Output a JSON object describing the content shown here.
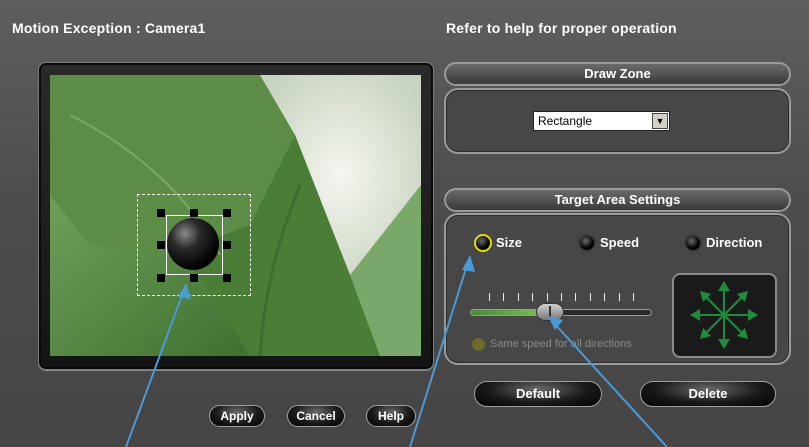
{
  "header": {
    "title": "Motion Exception : Camera1",
    "help_hint": "Refer to help for proper operation"
  },
  "draw_zone": {
    "title": "Draw Zone",
    "shape_select": {
      "value": "Rectangle"
    }
  },
  "target_area": {
    "title": "Target Area Settings",
    "options": [
      {
        "label": "Size",
        "selected": true
      },
      {
        "label": "Speed",
        "selected": false
      },
      {
        "label": "Direction",
        "selected": false
      }
    ],
    "speed_slider": {
      "tick_count": 11,
      "value": 0.42
    },
    "same_speed_label": "Same speed for all directions",
    "default_button": "Default",
    "delete_button": "Delete"
  },
  "footer": {
    "apply_button": "Apply",
    "cancel_button": "Cancel",
    "help_button": "Help"
  },
  "colors": {
    "background": "#4d4d4d",
    "selected_ring": "#e6dc00",
    "direction_arrows": "#1e8c3c",
    "callout_arrow": "#4a9ad8"
  }
}
